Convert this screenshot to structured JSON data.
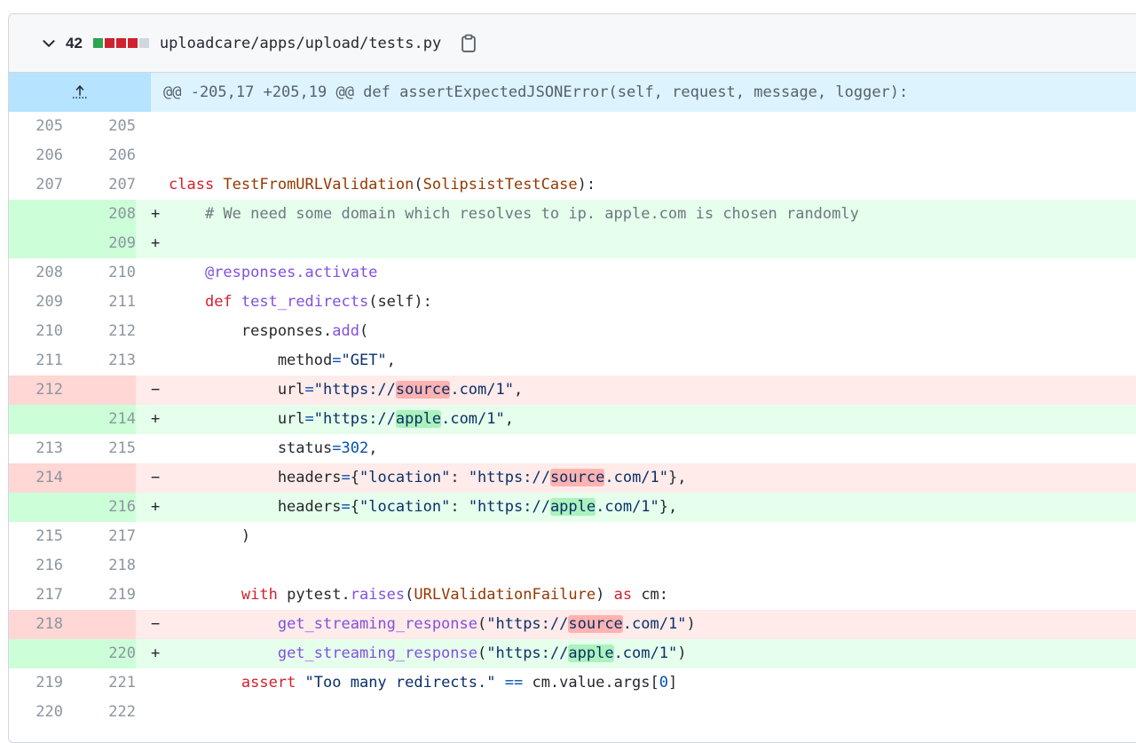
{
  "file": {
    "additions_count": "42",
    "path": "uploadcare/apps/upload/tests.py"
  },
  "hunk": {
    "header": "@@ -205,17 +205,19 @@ def assertExpectedJSONError(self, request, message, logger):"
  },
  "colors": {
    "addition": "#2da44e",
    "deletion": "#cf222e",
    "neutral": "#d0d7de",
    "hunk_bg": "#ddf4ff"
  },
  "lines": [
    {
      "old": "205",
      "new": "205",
      "type": "ctx",
      "sign": "",
      "segments": [
        {
          "t": ""
        }
      ]
    },
    {
      "old": "206",
      "new": "206",
      "type": "ctx",
      "sign": "",
      "segments": [
        {
          "t": ""
        }
      ]
    },
    {
      "old": "207",
      "new": "207",
      "type": "ctx",
      "sign": "",
      "segments": [
        {
          "t": "class ",
          "c": "kw"
        },
        {
          "t": "TestFromURLValidation",
          "c": "cls"
        },
        {
          "t": "("
        },
        {
          "t": "SolipsistTestCase",
          "c": "cls"
        },
        {
          "t": "):"
        }
      ]
    },
    {
      "old": "",
      "new": "208",
      "type": "add",
      "sign": "+",
      "segments": [
        {
          "t": "    # We need some domain which resolves to ip. apple.com is chosen randomly",
          "c": "cm"
        }
      ]
    },
    {
      "old": "",
      "new": "209",
      "type": "add",
      "sign": "+",
      "segments": [
        {
          "t": ""
        }
      ]
    },
    {
      "old": "208",
      "new": "210",
      "type": "ctx",
      "sign": "",
      "segments": [
        {
          "t": "    "
        },
        {
          "t": "@responses.activate",
          "c": "fn"
        }
      ]
    },
    {
      "old": "209",
      "new": "211",
      "type": "ctx",
      "sign": "",
      "segments": [
        {
          "t": "    "
        },
        {
          "t": "def ",
          "c": "kw"
        },
        {
          "t": "test_redirects",
          "c": "fn"
        },
        {
          "t": "(self):"
        }
      ]
    },
    {
      "old": "210",
      "new": "212",
      "type": "ctx",
      "sign": "",
      "segments": [
        {
          "t": "        responses."
        },
        {
          "t": "add",
          "c": "fn"
        },
        {
          "t": "("
        }
      ]
    },
    {
      "old": "211",
      "new": "213",
      "type": "ctx",
      "sign": "",
      "segments": [
        {
          "t": "            method"
        },
        {
          "t": "=",
          "c": "op"
        },
        {
          "t": "\"GET\"",
          "c": "str"
        },
        {
          "t": ","
        }
      ]
    },
    {
      "old": "212",
      "new": "",
      "type": "del",
      "sign": "−",
      "segments": [
        {
          "t": "            url"
        },
        {
          "t": "=",
          "c": "op"
        },
        {
          "t": "\"https://",
          "c": "str"
        },
        {
          "t": "source",
          "c": "str hl-del"
        },
        {
          "t": ".com/1\"",
          "c": "str"
        },
        {
          "t": ","
        }
      ]
    },
    {
      "old": "",
      "new": "214",
      "type": "add",
      "sign": "+",
      "segments": [
        {
          "t": "            url"
        },
        {
          "t": "=",
          "c": "op"
        },
        {
          "t": "\"https://",
          "c": "str"
        },
        {
          "t": "apple",
          "c": "str hl-add"
        },
        {
          "t": ".com/1\"",
          "c": "str"
        },
        {
          "t": ","
        }
      ]
    },
    {
      "old": "213",
      "new": "215",
      "type": "ctx",
      "sign": "",
      "segments": [
        {
          "t": "            status"
        },
        {
          "t": "=",
          "c": "op"
        },
        {
          "t": "302",
          "c": "numlit"
        },
        {
          "t": ","
        }
      ]
    },
    {
      "old": "214",
      "new": "",
      "type": "del",
      "sign": "−",
      "segments": [
        {
          "t": "            headers"
        },
        {
          "t": "=",
          "c": "op"
        },
        {
          "t": "{"
        },
        {
          "t": "\"location\"",
          "c": "str"
        },
        {
          "t": ": "
        },
        {
          "t": "\"https://",
          "c": "str"
        },
        {
          "t": "source",
          "c": "str hl-del"
        },
        {
          "t": ".com/1\"",
          "c": "str"
        },
        {
          "t": "},"
        }
      ]
    },
    {
      "old": "",
      "new": "216",
      "type": "add",
      "sign": "+",
      "segments": [
        {
          "t": "            headers"
        },
        {
          "t": "=",
          "c": "op"
        },
        {
          "t": "{"
        },
        {
          "t": "\"location\"",
          "c": "str"
        },
        {
          "t": ": "
        },
        {
          "t": "\"https://",
          "c": "str"
        },
        {
          "t": "apple",
          "c": "str hl-add"
        },
        {
          "t": ".com/1\"",
          "c": "str"
        },
        {
          "t": "},"
        }
      ]
    },
    {
      "old": "215",
      "new": "217",
      "type": "ctx",
      "sign": "",
      "segments": [
        {
          "t": "        )"
        }
      ]
    },
    {
      "old": "216",
      "new": "218",
      "type": "ctx",
      "sign": "",
      "segments": [
        {
          "t": ""
        }
      ]
    },
    {
      "old": "217",
      "new": "219",
      "type": "ctx",
      "sign": "",
      "segments": [
        {
          "t": "        "
        },
        {
          "t": "with ",
          "c": "kw"
        },
        {
          "t": "pytest."
        },
        {
          "t": "raises",
          "c": "fn"
        },
        {
          "t": "("
        },
        {
          "t": "URLValidationFailure",
          "c": "cls"
        },
        {
          "t": ") "
        },
        {
          "t": "as ",
          "c": "kw"
        },
        {
          "t": "cm:"
        }
      ]
    },
    {
      "old": "218",
      "new": "",
      "type": "del",
      "sign": "−",
      "segments": [
        {
          "t": "            "
        },
        {
          "t": "get_streaming_response",
          "c": "fn"
        },
        {
          "t": "("
        },
        {
          "t": "\"https://",
          "c": "str"
        },
        {
          "t": "source",
          "c": "str hl-del"
        },
        {
          "t": ".com/1\"",
          "c": "str"
        },
        {
          "t": ")"
        }
      ]
    },
    {
      "old": "",
      "new": "220",
      "type": "add",
      "sign": "+",
      "segments": [
        {
          "t": "            "
        },
        {
          "t": "get_streaming_response",
          "c": "fn"
        },
        {
          "t": "("
        },
        {
          "t": "\"https://",
          "c": "str"
        },
        {
          "t": "apple",
          "c": "str hl-add"
        },
        {
          "t": ".com/1\"",
          "c": "str"
        },
        {
          "t": ")"
        }
      ]
    },
    {
      "old": "219",
      "new": "221",
      "type": "ctx",
      "sign": "",
      "segments": [
        {
          "t": "        "
        },
        {
          "t": "assert ",
          "c": "kw"
        },
        {
          "t": "\"Too many redirects.\"",
          "c": "str"
        },
        {
          "t": " "
        },
        {
          "t": "==",
          "c": "op"
        },
        {
          "t": " cm.value.args["
        },
        {
          "t": "0",
          "c": "numlit"
        },
        {
          "t": "]"
        }
      ]
    },
    {
      "old": "220",
      "new": "222",
      "type": "ctx",
      "sign": "",
      "segments": [
        {
          "t": ""
        }
      ]
    }
  ]
}
